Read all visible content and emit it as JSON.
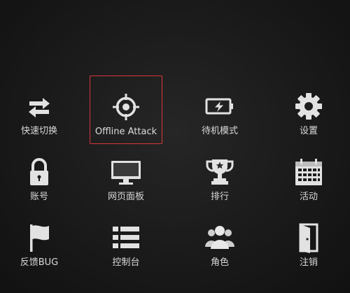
{
  "menu": {
    "items": [
      {
        "label": "快速切换",
        "icon": "swap-arrows-icon"
      },
      {
        "label": "Offline Attack",
        "icon": "crosshair-icon",
        "selected": true
      },
      {
        "label": "待机模式",
        "icon": "battery-charging-icon"
      },
      {
        "label": "设置",
        "icon": "gear-icon"
      },
      {
        "label": "账号",
        "icon": "padlock-icon"
      },
      {
        "label": "网页面板",
        "icon": "monitor-icon"
      },
      {
        "label": "排行",
        "icon": "trophy-icon"
      },
      {
        "label": "活动",
        "icon": "calendar-icon"
      },
      {
        "label": "反馈BUG",
        "icon": "flag-icon"
      },
      {
        "label": "控制台",
        "icon": "list-icon"
      },
      {
        "label": "角色",
        "icon": "people-icon"
      },
      {
        "label": "注销",
        "icon": "logout-door-icon"
      }
    ]
  },
  "colors": {
    "icon": "#e2e2e2",
    "label": "#d9d9d9",
    "selection_border": "#d8363a",
    "background": "#1a1a1a"
  }
}
